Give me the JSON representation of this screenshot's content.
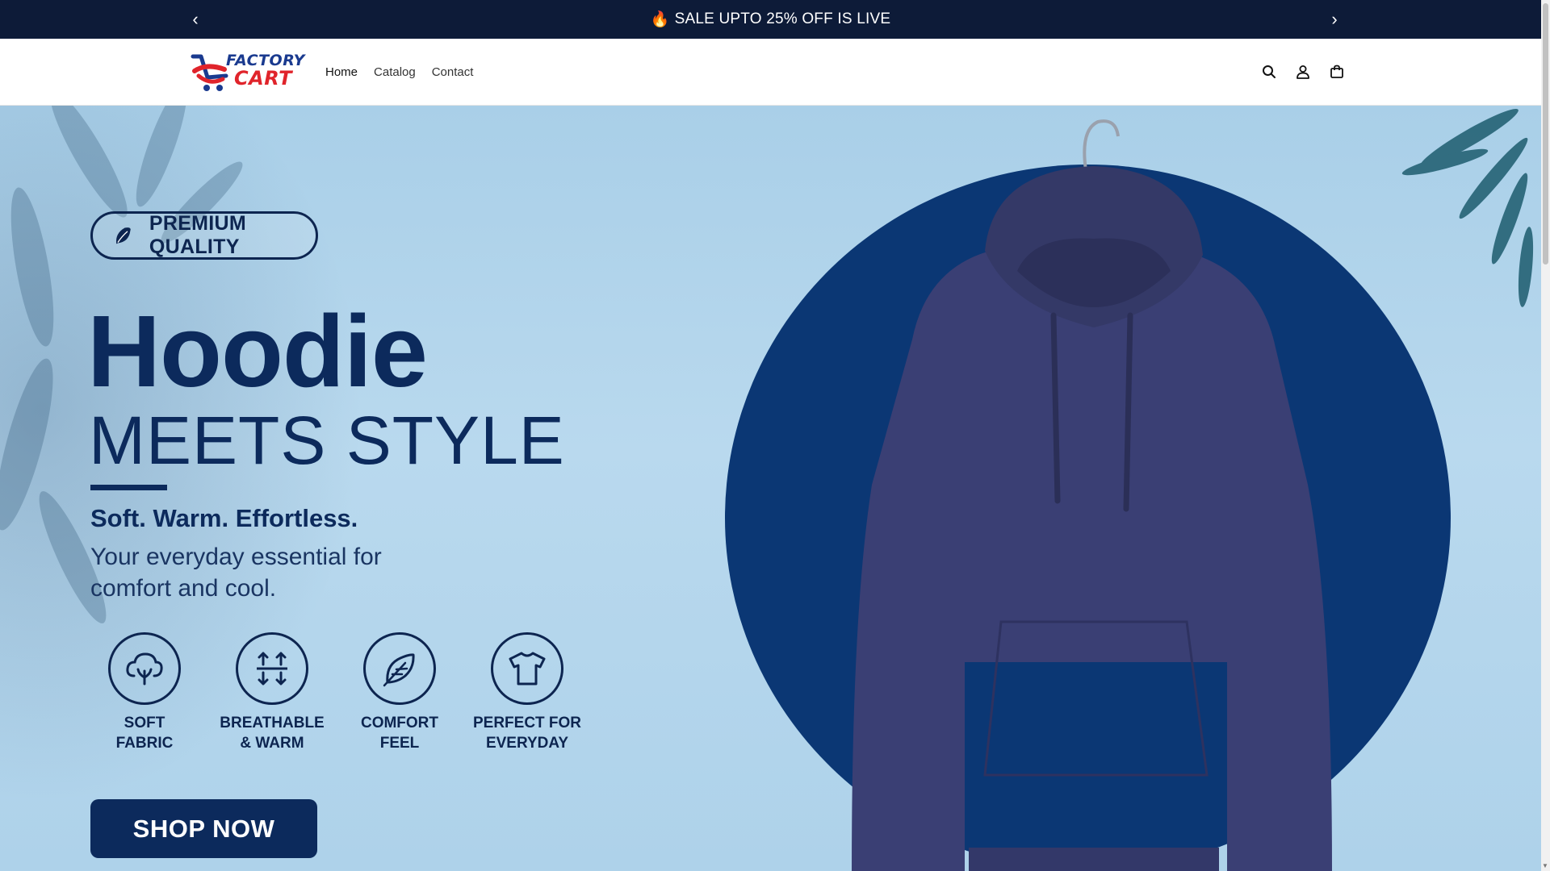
{
  "announcement": {
    "prev_label": "‹",
    "next_label": "›",
    "fire": "🔥",
    "text": "SALE UPTO 25% OFF IS LIVE"
  },
  "header": {
    "logo": {
      "line1": "FACTORY",
      "line2": "CART"
    },
    "nav": [
      {
        "label": "Home",
        "active": true
      },
      {
        "label": "Catalog",
        "active": false
      },
      {
        "label": "Contact",
        "active": false
      }
    ],
    "icons": [
      "search-icon",
      "account-icon",
      "cart-icon"
    ]
  },
  "hero": {
    "badge": "PREMIUM QUALITY",
    "title": "Hoodie",
    "subtitle": "MEETS STYLE",
    "tagline": "Soft. Warm. Effortless.",
    "description": "Your everyday essential for comfort and cool.",
    "features": [
      {
        "line1": "SOFT",
        "line2": "FABRIC",
        "icon": "cloud-leaf-icon"
      },
      {
        "line1": "BREATHABLE",
        "line2": "& WARM",
        "icon": "airflow-arrows-icon"
      },
      {
        "line1": "COMFORT",
        "line2": "FEEL",
        "icon": "feather-icon"
      },
      {
        "line1": "PERFECT FOR",
        "line2": "EVERYDAY",
        "icon": "tshirt-icon"
      }
    ],
    "cta": "SHOP NOW",
    "colors": {
      "primary": "#0c2a5c",
      "circle": "#0b3774",
      "hoodie": "#3a3f74",
      "background": "#b4d6ec"
    }
  }
}
